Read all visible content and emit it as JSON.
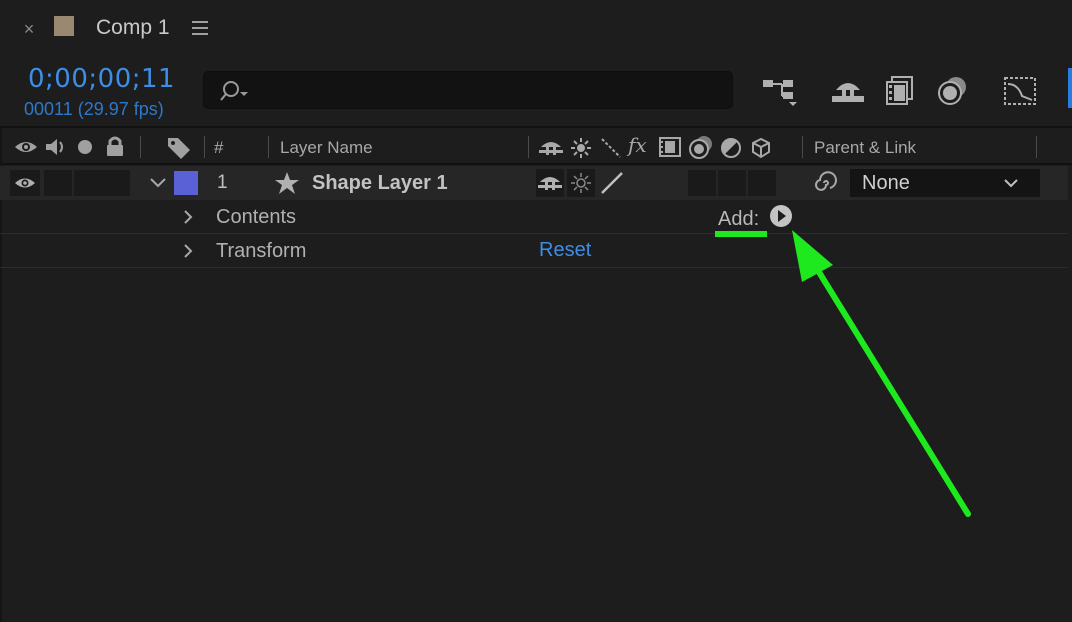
{
  "tab": {
    "close_glyph": "×",
    "title": "Comp 1",
    "swatch_color": "#9a8970"
  },
  "time": {
    "timecode": "0;00;00;11",
    "frames": "00011 (29.97 fps)"
  },
  "search": {
    "value": "",
    "icon": "search-icon"
  },
  "toolbar": {
    "icons": [
      "composition-flowchart-icon",
      "shy-layers-icon",
      "frame-blending-icon",
      "motion-blur-icon",
      "graph-editor-icon"
    ]
  },
  "header": {
    "number": "#",
    "layer_name": "Layer Name",
    "fx": "fx",
    "parent_link": "Parent & Link"
  },
  "layer": {
    "number": "1",
    "name": "Shape Layer 1",
    "label_color": "#5a60d6",
    "parent": "None"
  },
  "rows": {
    "contents": "Contents",
    "transform": "Transform",
    "add": "Add:",
    "reset": "Reset"
  },
  "annotation": {
    "arrow_color": "#1ee81e"
  }
}
